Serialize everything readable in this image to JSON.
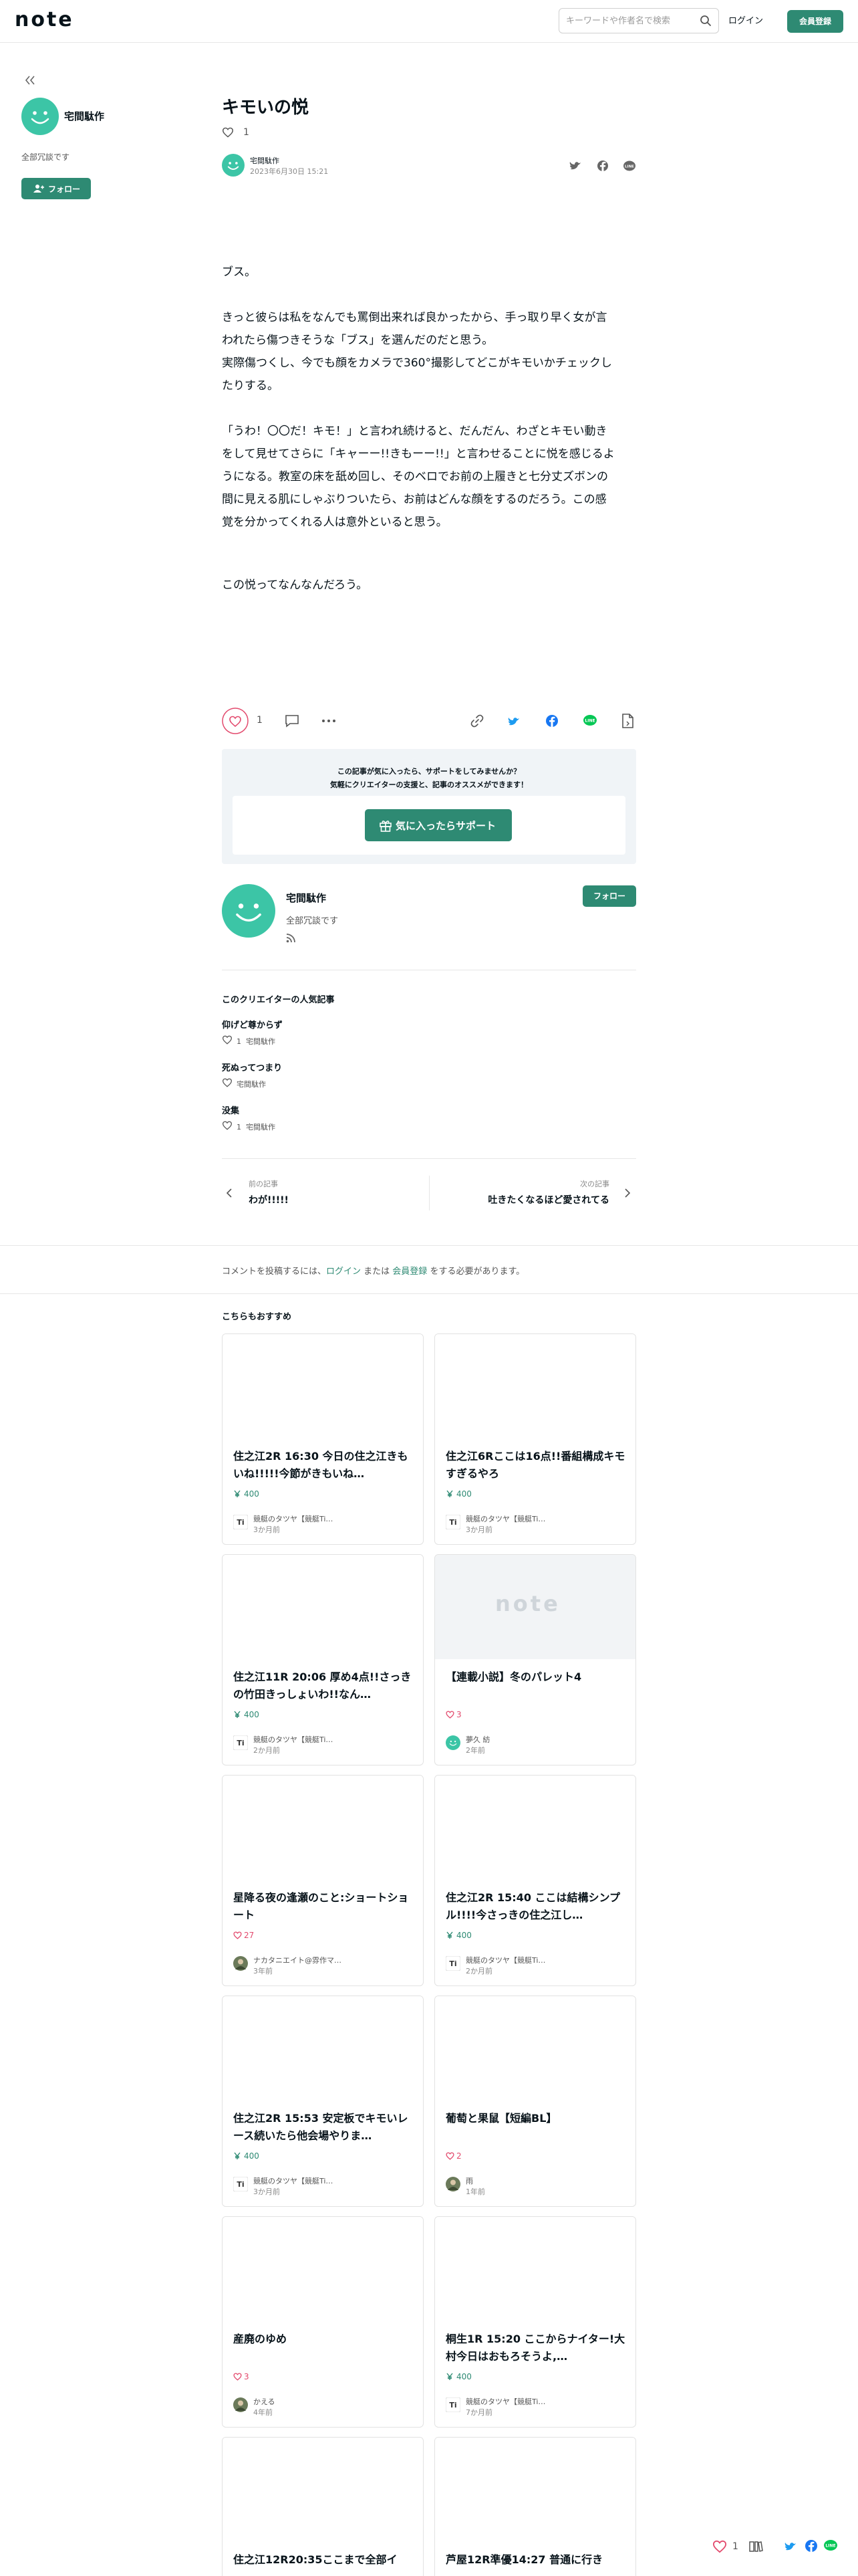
{
  "header": {
    "logo": "note",
    "search_placeholder": "キーワードや作者名で検索",
    "login_label": "ログイン",
    "signup_label": "会員登録"
  },
  "sidebar": {
    "creator_name": "宅間駄作",
    "creator_desc": "全部冗談です",
    "follow_label": "フォロー"
  },
  "article": {
    "title": "キモいの悦",
    "like_count": "1",
    "author": "宅間駄作",
    "date": "2023年6月30日 15:21",
    "paragraphs": [
      [
        "ブス。"
      ],
      [
        "きっと彼らは私をなんでも罵倒出来れば良かったから、手っ取り早く女が言",
        "われたら傷つきそうな「ブス」を選んだのだと思う。",
        "実際傷つくし、今でも顔をカメラで360°撮影してどこがキモいかチェックし",
        "たりする。"
      ],
      [
        "「うわ！〇〇だ！キモ！」と言われ続けると、だんだん、わざとキモい動き",
        "をして見せてさらに「キャーー!!きもーー!!」と言わせることに悦を感じるよ",
        "うになる。教室の床を舐め回し、そのベロでお前の上履きと七分丈ズボンの",
        "間に見える肌にしゃぶりついたら、お前はどんな顔をするのだろう。この感",
        "覚を分かってくれる人は意外といると思う。"
      ],
      [
        "この悦ってなんなんだろう。"
      ]
    ]
  },
  "actions": {
    "like_count": "1"
  },
  "support": {
    "message_line1": "この記事が気に入ったら、サポートをしてみませんか？",
    "message_line2": "気軽にクリエイターの支援と、記事のオススメができます！",
    "button_label": "気に入ったらサポート"
  },
  "profile": {
    "name": "宅間駄作",
    "desc": "全部冗談です",
    "follow_label": "フォロー"
  },
  "popular": {
    "heading": "このクリエイターの人気記事",
    "items": [
      {
        "title": "仰げど尊からず",
        "likes": "1",
        "author": "宅間駄作"
      },
      {
        "title": "死ぬってつまり",
        "likes": "",
        "author": "宅間駄作"
      },
      {
        "title": "没集",
        "likes": "1",
        "author": "宅間駄作"
      }
    ]
  },
  "nav": {
    "prev_label": "前の記事",
    "prev_title": "わが!!!!!",
    "next_label": "次の記事",
    "next_title": "吐きたくなるほど愛されてる"
  },
  "comment": {
    "prefix": "コメントを投稿するには、",
    "login_link": "ログイン",
    "middle": " または ",
    "signup_link": "会員登録",
    "suffix": " をする必要があります。"
  },
  "recommend": {
    "heading": "こちらもおすすめ",
    "cards": [
      {
        "title": "住之江2R 16:30 今日の住之江きもいね!!!!!今節がきもいね…",
        "stat_type": "price",
        "stat": "400",
        "author": "競艇のタツヤ【競艇Ti…",
        "date": "3か月前",
        "thumb": "blank",
        "avatar": "logo"
      },
      {
        "title": "住之江6Rここは16点!!番組構成キモすぎるやろ",
        "stat_type": "price",
        "stat": "400",
        "author": "競艇のタツヤ【競艇Ti…",
        "date": "3か月前",
        "thumb": "blank",
        "avatar": "logo"
      },
      {
        "title": "住之江11R 20:06 厚め4点!!さっきの竹田きっしょいわ!!なん…",
        "stat_type": "price",
        "stat": "400",
        "author": "競艇のタツヤ【競艇Ti…",
        "date": "2か月前",
        "thumb": "blank",
        "avatar": "logo"
      },
      {
        "title": "【連載小説】冬のパレット4",
        "stat_type": "like",
        "stat": "3",
        "author": "夢久 紡",
        "date": "2年前",
        "thumb": "placeholder",
        "avatar": "smile"
      },
      {
        "title": "星降る夜の逢瀬のこと:ショートショート",
        "stat_type": "like",
        "stat": "27",
        "author": "ナカタニエイト@雰作マ…",
        "date": "3年前",
        "thumb": "blank",
        "avatar": "person"
      },
      {
        "title": "住之江2R 15:40 ここは結構シンプル!!!!今さっきの住之江し…",
        "stat_type": "price",
        "stat": "400",
        "author": "競艇のタツヤ【競艇Ti…",
        "date": "2か月前",
        "thumb": "blank",
        "avatar": "logo"
      },
      {
        "title": "住之江2R 15:53 安定板でキモいレース続いたら他会場やりま…",
        "stat_type": "price",
        "stat": "400",
        "author": "競艇のタツヤ【競艇Ti…",
        "date": "3か月前",
        "thumb": "blank",
        "avatar": "logo"
      },
      {
        "title": "葡萄と果鼠【短編BL】",
        "stat_type": "like",
        "stat": "2",
        "author": "雨",
        "date": "1年前",
        "thumb": "blank",
        "avatar": "person"
      },
      {
        "title": "産廃のゆめ",
        "stat_type": "like",
        "stat": "3",
        "author": "かえる",
        "date": "4年前",
        "thumb": "blank",
        "avatar": "person"
      },
      {
        "title": "桐生1R 15:20 ここからナイター!大村今日はおもろそうよ,…",
        "stat_type": "price",
        "stat": "400",
        "author": "競艇のタツヤ【競艇Ti…",
        "date": "7か月前",
        "thumb": "blank",
        "avatar": "logo"
      },
      {
        "title": "住之江12R20:35ここまで全部イ",
        "stat_type": "",
        "stat": "",
        "author": "",
        "date": "",
        "thumb": "blank",
        "avatar": "none"
      },
      {
        "title": "芦屋12R準優14:27 普通に行き",
        "stat_type": "",
        "stat": "",
        "author": "",
        "date": "",
        "thumb": "blank",
        "avatar": "none"
      }
    ]
  },
  "floating": {
    "like_count": "1"
  },
  "colors": {
    "brand": "#2e8a73",
    "like": "#e34b6e",
    "avatar": "#3cc5a6",
    "twitter": "#1d9bf0",
    "facebook": "#1877f2",
    "line": "#06c755"
  }
}
